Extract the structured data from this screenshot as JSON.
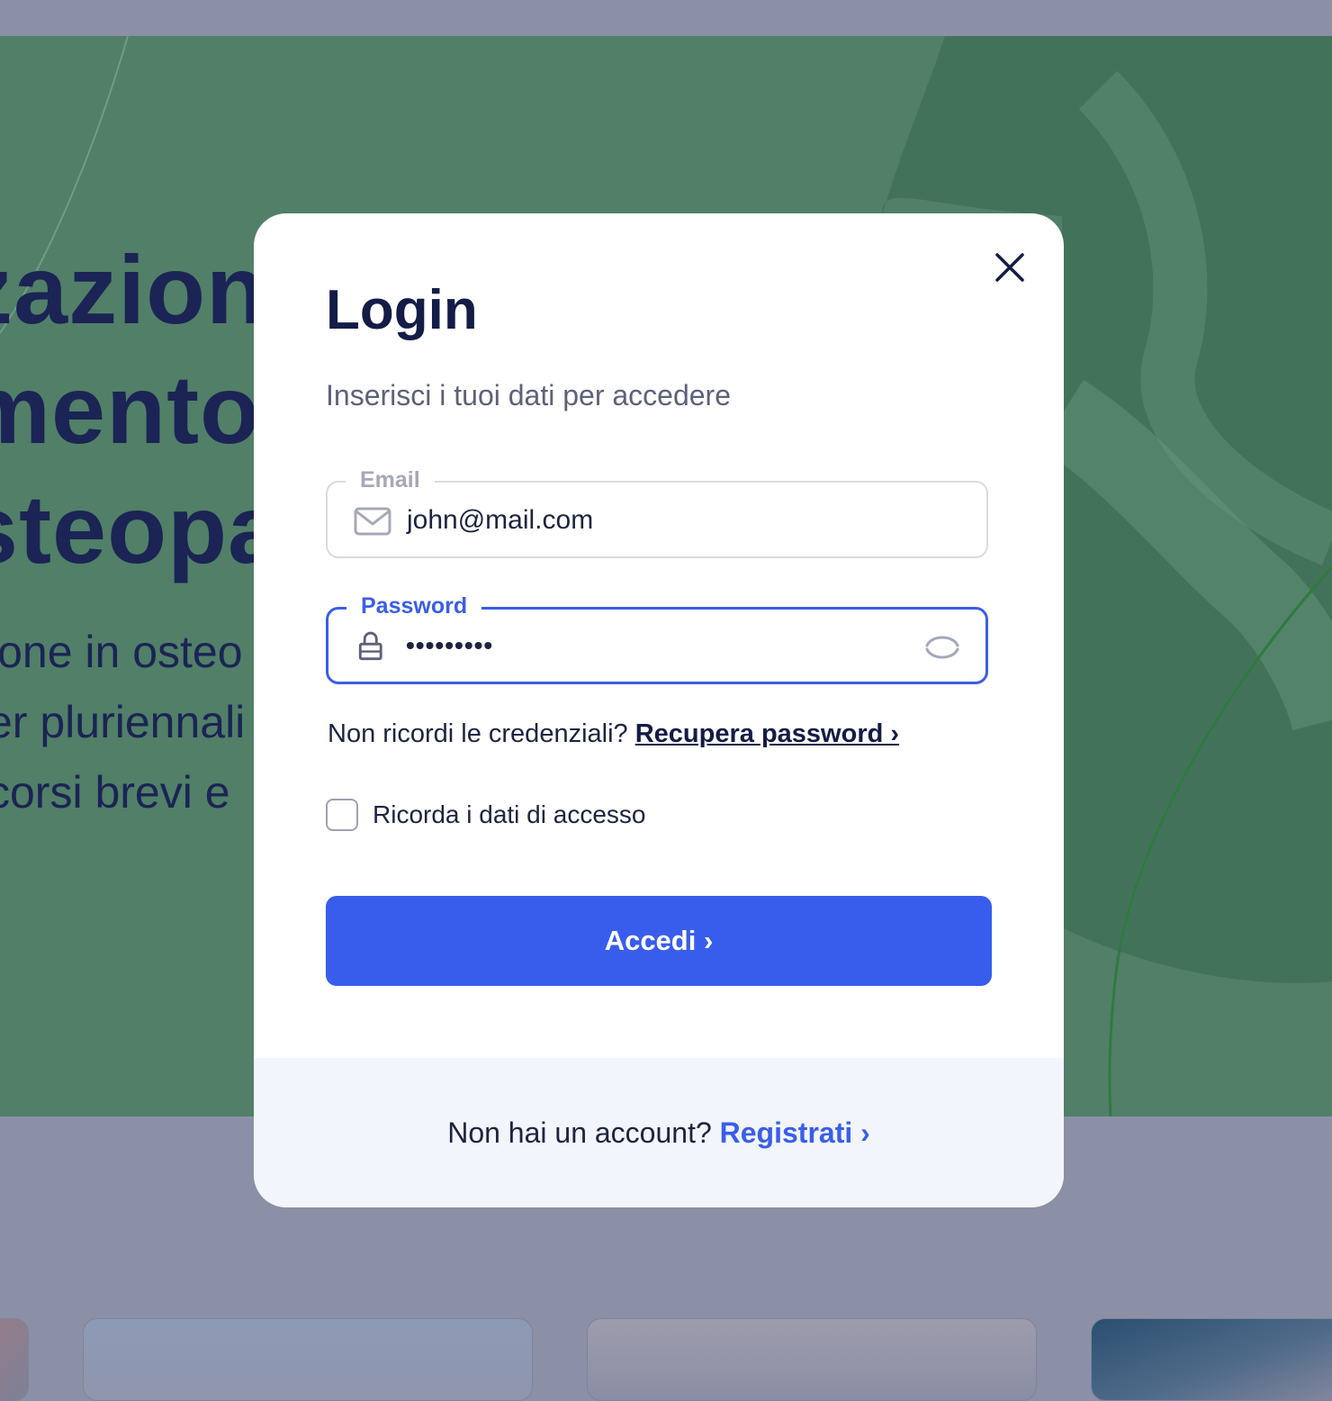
{
  "background": {
    "hero_title_lines": [
      "zazion",
      "mento",
      "steopa"
    ],
    "hero_subtitle_lines": [
      "ione in osteo",
      "er pluriennali",
      "corsi brevi e"
    ],
    "hero_color": "#517f68",
    "overlay_color": "#8c90a6"
  },
  "modal": {
    "title": "Login",
    "subtitle": "Inserisci i tuoi dati per accedere",
    "close_icon": "close-icon",
    "email": {
      "label": "Email",
      "value": "john@mail.com",
      "icon": "envelope-icon"
    },
    "password": {
      "label": "Password",
      "masked_value": "•••••••••",
      "icon": "lock-icon",
      "toggle_icon": "eye-toggle-icon"
    },
    "recover": {
      "prompt": "Non ricordi le credenziali?",
      "link_label": "Recupera password ›"
    },
    "remember": {
      "label": "Ricorda i dati di accesso",
      "checked": false
    },
    "submit_label": "Accedi ›",
    "footer": {
      "prompt": "Non hai un account?",
      "link_label": "Registrati ›"
    }
  },
  "colors": {
    "primary": "#385ded",
    "navy": "#141c47",
    "footer_bg": "#f2f5fb"
  }
}
